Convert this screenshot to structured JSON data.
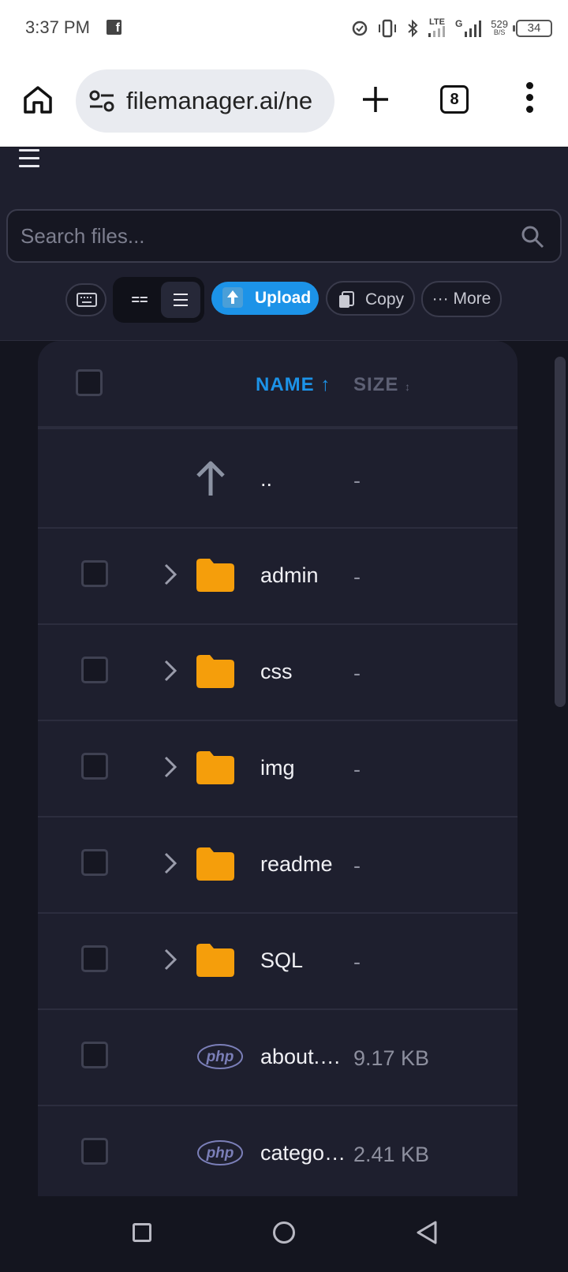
{
  "status_bar": {
    "time": "3:37 PM",
    "network_type": "LTE",
    "signal2_label": "G",
    "net_speed_value": "529",
    "net_speed_unit": "B/S",
    "battery": "34"
  },
  "browser": {
    "url": "filemanager.ai/ne",
    "tab_count": "8"
  },
  "search": {
    "placeholder": "Search files..."
  },
  "toolbar": {
    "view_grid_label": "==",
    "upload_label": "Upload",
    "copy_label": "Copy",
    "more_label": "··· More"
  },
  "table": {
    "headers": {
      "name": "NAME ↑",
      "size": "SIZE",
      "size_sort": "↕"
    },
    "rows": [
      {
        "name": "..",
        "size": "-",
        "kind": "parent"
      },
      {
        "name": "admin",
        "size": "-",
        "kind": "folder"
      },
      {
        "name": "css",
        "size": "-",
        "kind": "folder"
      },
      {
        "name": "img",
        "size": "-",
        "kind": "folder"
      },
      {
        "name": "readme",
        "size": "-",
        "kind": "folder"
      },
      {
        "name": "SQL",
        "size": "-",
        "kind": "folder"
      },
      {
        "name": "about.php",
        "size": "9.17 KB",
        "kind": "php"
      },
      {
        "name": "category.php",
        "size": "2.41 KB",
        "kind": "php"
      }
    ]
  },
  "icons": {
    "php_label": "php"
  },
  "colors": {
    "accent": "#1c93e8",
    "folder": "#f59e0b",
    "panel": "#1e1f2e",
    "background": "#14151f"
  }
}
